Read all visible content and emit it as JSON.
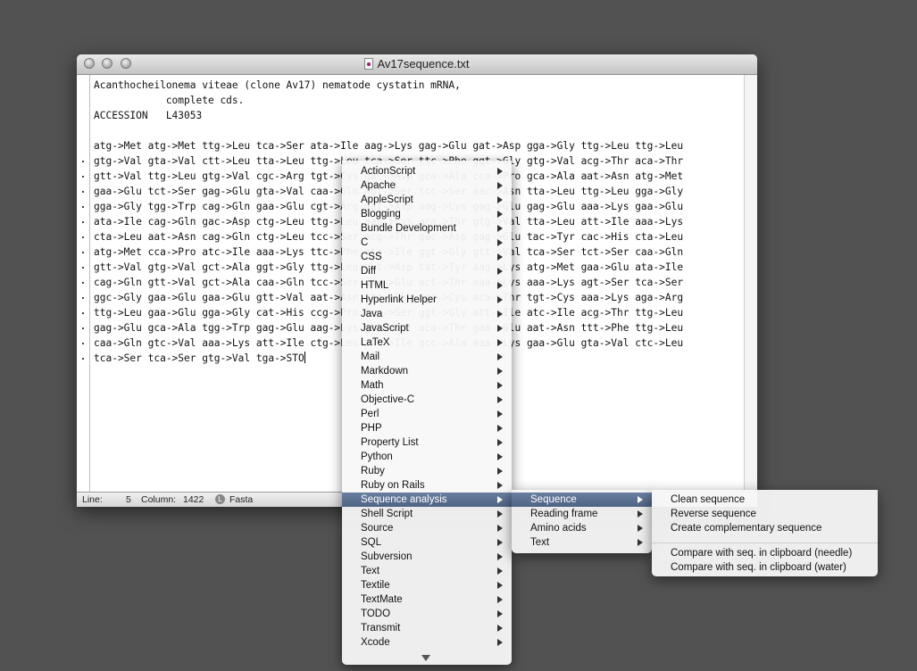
{
  "window": {
    "title": "Av17sequence.txt",
    "buttons": [
      "close",
      "minimize",
      "zoom"
    ],
    "title_icon": "text-document-icon"
  },
  "editor": {
    "lines": [
      "Acanthocheilonema viteae (clone Av17) nematode cystatin mRNA,",
      "            complete cds.",
      "ACCESSION   L43053",
      "",
      "atg->Met atg->Met ttg->Leu tca->Ser ata->Ile aag->Lys gag->Glu gat->Asp gga->Gly ttg->Leu ttg->Leu",
      "gtg->Val gta->Val ctt->Leu tta->Leu ttg->Leu tca->Ser ttc->Phe ggt->Gly gtg->Val acg->Thr aca->Thr",
      "gtt->Val ttg->Leu gtg->Val cgc->Arg tgt->Cys gac->Asp gca->Ala cca->Pro gca->Ala aat->Asn atg->Met",
      "gaa->Glu tct->Ser gag->Glu gta->Val caa->Gln agt->Ser tcc->Ser aac->Asn tta->Leu ttg->Leu gga->Gly",
      "gga->Gly tgg->Trp cag->Gln gaa->Glu cgt->Arg gat->Asp aag->Lys gag->Glu gag->Glu aaa->Lys gaa->Glu",
      "ata->Ile cag->Gln gac->Asp ctg->Leu ttg->Leu aag->Lys aca->Thr gtg->Val tta->Leu att->Ile aaa->Lys",
      "cta->Leu aat->Asn cag->Gln ctg->Leu tcc->Ser acg->Thr gac->Asp gag->Glu tac->Tyr cac->His cta->Leu",
      "atg->Met cca->Pro atc->Ile aaa->Lys ttc->Phe ata->Ile ggt->Gly gtt->Val tca->Ser tct->Ser caa->Gln",
      "gtt->Val gtg->Val gct->Ala ggt->Gly ttg->Leu gat->Asp tat->Tyr aag->Lys atg->Met gaa->Glu ata->Ile",
      "cag->Gln gtt->Val gct->Ala caa->Gln tcc->Ser gaa->Glu act->Thr aaa->Lys aaa->Lys agt->Ser tca->Ser",
      "ggc->Gly gaa->Glu gaa->Glu gtt->Val aat->Asn ttt->Phe tgc->Cys aca->Thr tgt->Cys aaa->Lys aga->Arg",
      "ttg->Leu gaa->Glu gga->Gly cat->His ccg->Pro tca->Ser ggt->Gly att->Ile atc->Ile acg->Thr ttg->Leu",
      "gag->Glu gca->Ala tgg->Trp gag->Glu aag->Lys gtt->Val aca->Thr gaa->Glu aat->Asn ttt->Phe ttg->Leu",
      "caa->Gln gtc->Val aaa->Lys att->Ile ctg->Leu att->Ile gcc->Ala aaa->Lys gaa->Glu gta->Val ctc->Leu",
      "tca->Ser tca->Ser gtg->Val tga->STO"
    ]
  },
  "statusbar": {
    "line_label": "Line:",
    "line_value": "5",
    "column_label": "Column:",
    "column_value": "1422",
    "language": "Fasta"
  },
  "bundles_menu": {
    "items": [
      "ActionScript",
      "Apache",
      "AppleScript",
      "Blogging",
      "Bundle Development",
      "C",
      "CSS",
      "Diff",
      "HTML",
      "Hyperlink Helper",
      "Java",
      "JavaScript",
      "LaTeX",
      "Mail",
      "Markdown",
      "Math",
      "Objective-C",
      "Perl",
      "PHP",
      "Property List",
      "Python",
      "Ruby",
      "Ruby on Rails",
      "Sequence analysis",
      "Shell Script",
      "Source",
      "SQL",
      "Subversion",
      "Text",
      "Textile",
      "TextMate",
      "TODO",
      "Transmit",
      "Xcode"
    ],
    "selected": "Sequence analysis",
    "more_indicator": "scroll-down-arrow-icon"
  },
  "sequence_menu": {
    "items": [
      "Sequence",
      "Reading frame",
      "Amino acids",
      "Text"
    ],
    "selected": "Sequence"
  },
  "commands_menu": {
    "group1": [
      "Clean sequence",
      "Reverse sequence",
      "Create complementary sequence"
    ],
    "group2": [
      "Compare with seq. in clipboard (needle)",
      "Compare with seq. in clipboard (water)"
    ]
  },
  "colors": {
    "desktop": "#525252",
    "menu_highlight": "#5a6d8f",
    "menu_background": "#f8f8f8"
  }
}
